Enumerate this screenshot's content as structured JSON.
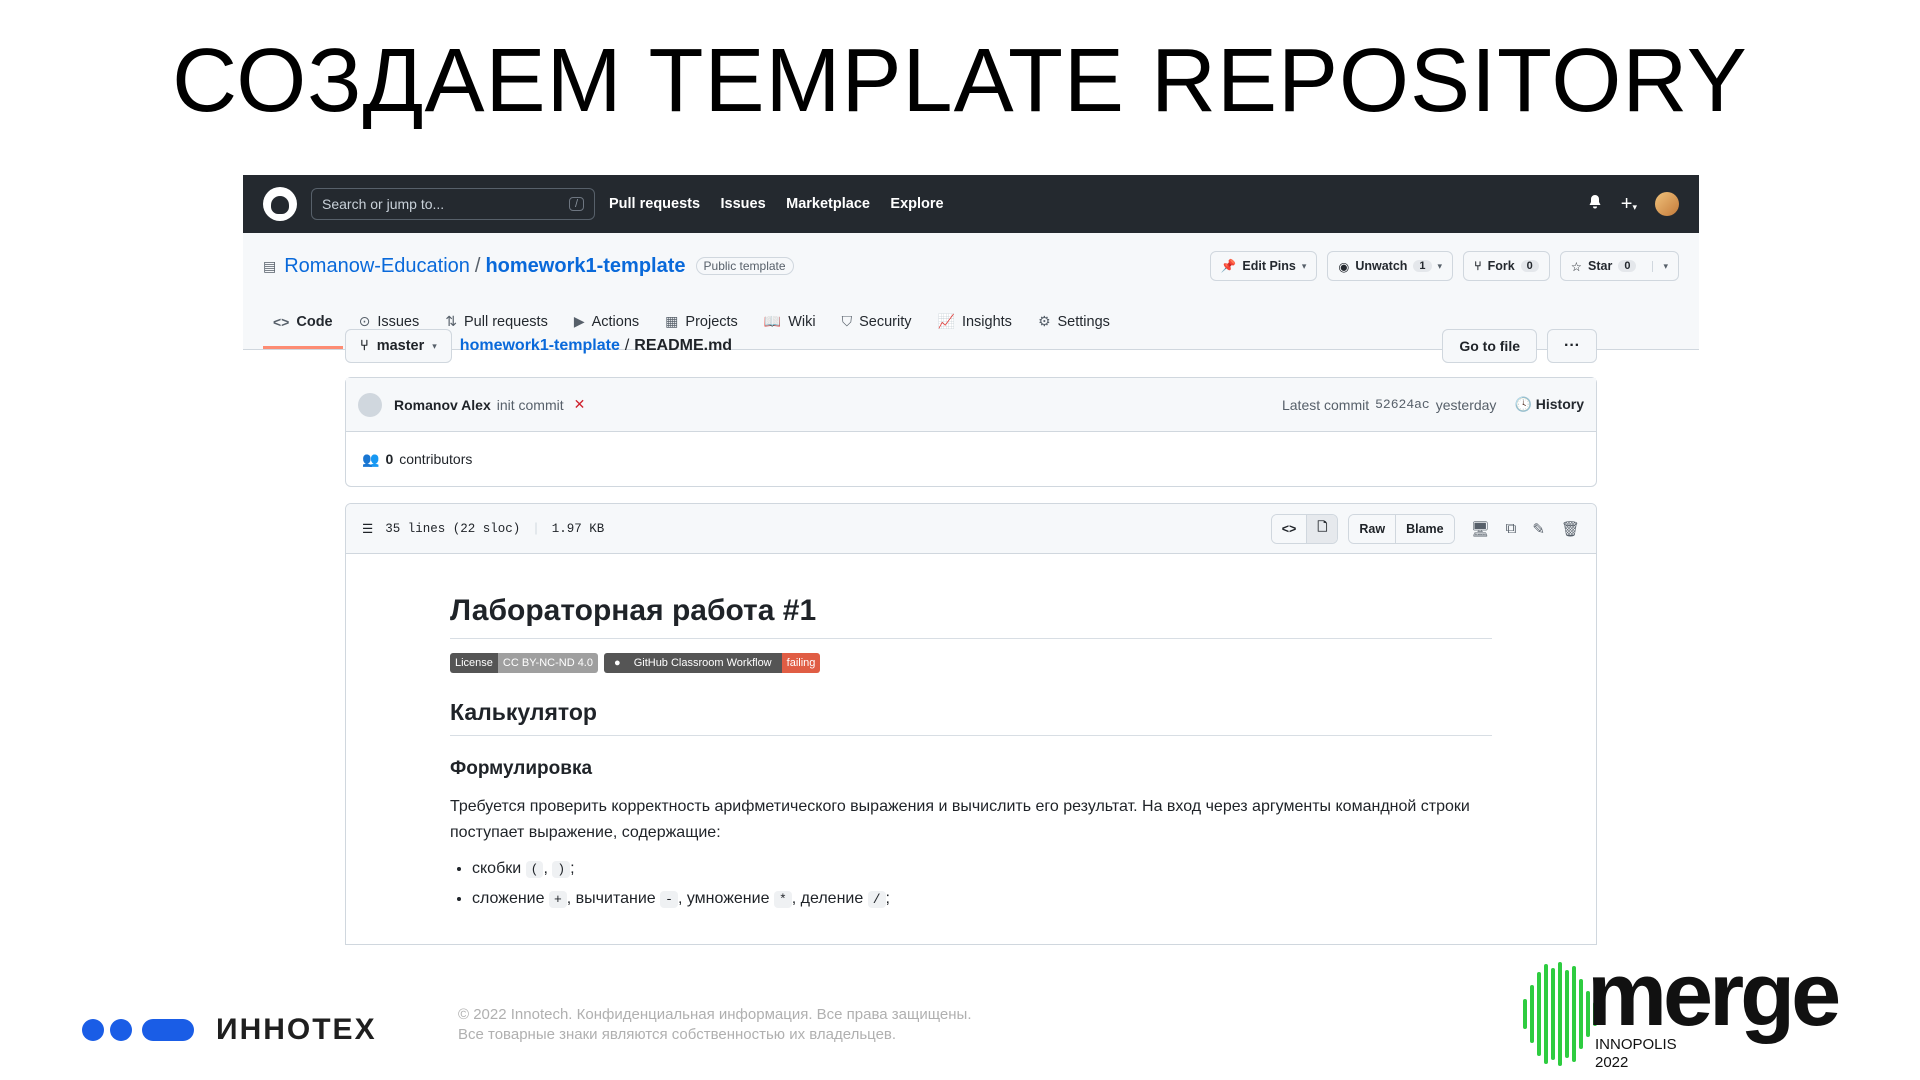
{
  "slide": {
    "title": "СОЗДАЕМ TEMPLATE REPOSITORY"
  },
  "gh": {
    "search_placeholder": "Search or jump to...",
    "slash": "/",
    "nav": [
      "Pull requests",
      "Issues",
      "Marketplace",
      "Explore"
    ],
    "icons": [
      "github-logo",
      "bell-icon",
      "plus-icon",
      "avatar"
    ]
  },
  "repo": {
    "owner": "Romanow-Education",
    "sep": "/",
    "name": "homework1-template",
    "visibility": "Public template",
    "edit_pins": "Edit Pins",
    "unwatch": "Unwatch",
    "watch_count": "1",
    "fork": "Fork",
    "fork_count": "0",
    "star": "Star",
    "star_count": "0",
    "tabs": [
      "Code",
      "Issues",
      "Pull requests",
      "Actions",
      "Projects",
      "Wiki",
      "Security",
      "Insights",
      "Settings"
    ],
    "active_tab": "Code"
  },
  "file_nav": {
    "branch": "master",
    "repo_crumb": "homework1-template",
    "crumb_sep": "/",
    "file": "README.md",
    "goto_file": "Go to file",
    "more": "···"
  },
  "commit": {
    "author": "Romanov Alex",
    "message": "init commit",
    "status": "✕",
    "latest_label": "Latest commit",
    "sha": "52624ac",
    "when": "yesterday",
    "history": "History",
    "contributors_count": "0",
    "contributors_label": "contributors"
  },
  "file_head": {
    "lines": "35 lines (22 sloc)",
    "size": "1.97 KB",
    "raw": "Raw",
    "blame": "Blame"
  },
  "readme": {
    "h1": "Лабораторная работа #1",
    "badge_license_label": "License",
    "badge_license_value": "CC BY-NC-ND 4.0",
    "badge_workflow_label": "GitHub Classroom Workflow",
    "badge_workflow_value": "failing",
    "h2": "Калькулятор",
    "h3": "Формулировка",
    "p": "Требуется проверить корректность арифметического выражения и вычислить его результат. На вход через аргументы командной строки поступает выражение, содержащие:",
    "li1_text": "скобки",
    "li1_code_a": "(",
    "li1_code_b": ")",
    "li2_add": "сложение",
    "li2_code_add": "+",
    "li2_sub": "вычитание",
    "li2_code_sub": "-",
    "li2_mul": "умножение",
    "li2_code_mul": "*",
    "li2_div": "деление",
    "li2_code_div": "/"
  },
  "footer": {
    "brand": "ИННОТЕХ",
    "copyright_line1": "© 2022 Innotech. Конфиденциальная информация. Все права защищены.",
    "copyright_line2": "Все товарные знаки являются собственностью их владельцев.",
    "merge_word": "merge",
    "merge_city": "INNOPOLIS",
    "merge_year": "2022"
  },
  "colors": {
    "gh_header": "#24292f",
    "link": "#0969da",
    "tab_underline": "#fd8c73",
    "failing": "#e05d44",
    "brand_blue": "#1a5de6",
    "merge_green": "#2ecc40"
  }
}
